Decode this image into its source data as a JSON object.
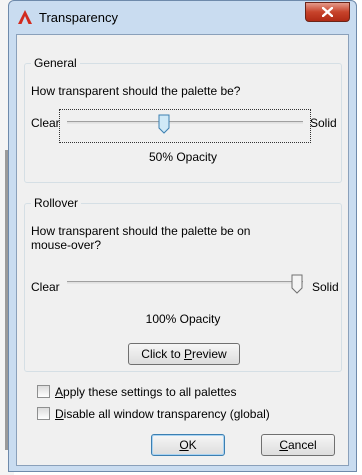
{
  "window": {
    "title": "Transparency"
  },
  "general": {
    "title": "General",
    "question": "How transparent should the palette be?",
    "clear_label": "Clear",
    "solid_label": "Solid",
    "opacity_text": "50% Opacity",
    "slider_value": 0.5
  },
  "rollover": {
    "title": "Rollover",
    "question": "How transparent should the palette be on mouse-over?",
    "clear_label": "Clear",
    "solid_label": "Solid",
    "opacity_text": "100% Opacity",
    "slider_value": 1.0,
    "preview_button": {
      "label_pre": "Click to ",
      "accel": "P",
      "label_post": "review"
    }
  },
  "options": {
    "apply_all": {
      "accel": "A",
      "label_rest": "pply these settings to all palettes",
      "checked": false
    },
    "disable_all": {
      "accel": "D",
      "label_rest": "isable all window transparency (global)",
      "checked": false
    }
  },
  "buttons": {
    "ok": {
      "accel": "O",
      "rest": "K"
    },
    "cancel": {
      "accel": "C",
      "rest": "ancel"
    }
  },
  "colors": {
    "title_icon": "#d22b1f",
    "close_button": "#c7432b"
  }
}
